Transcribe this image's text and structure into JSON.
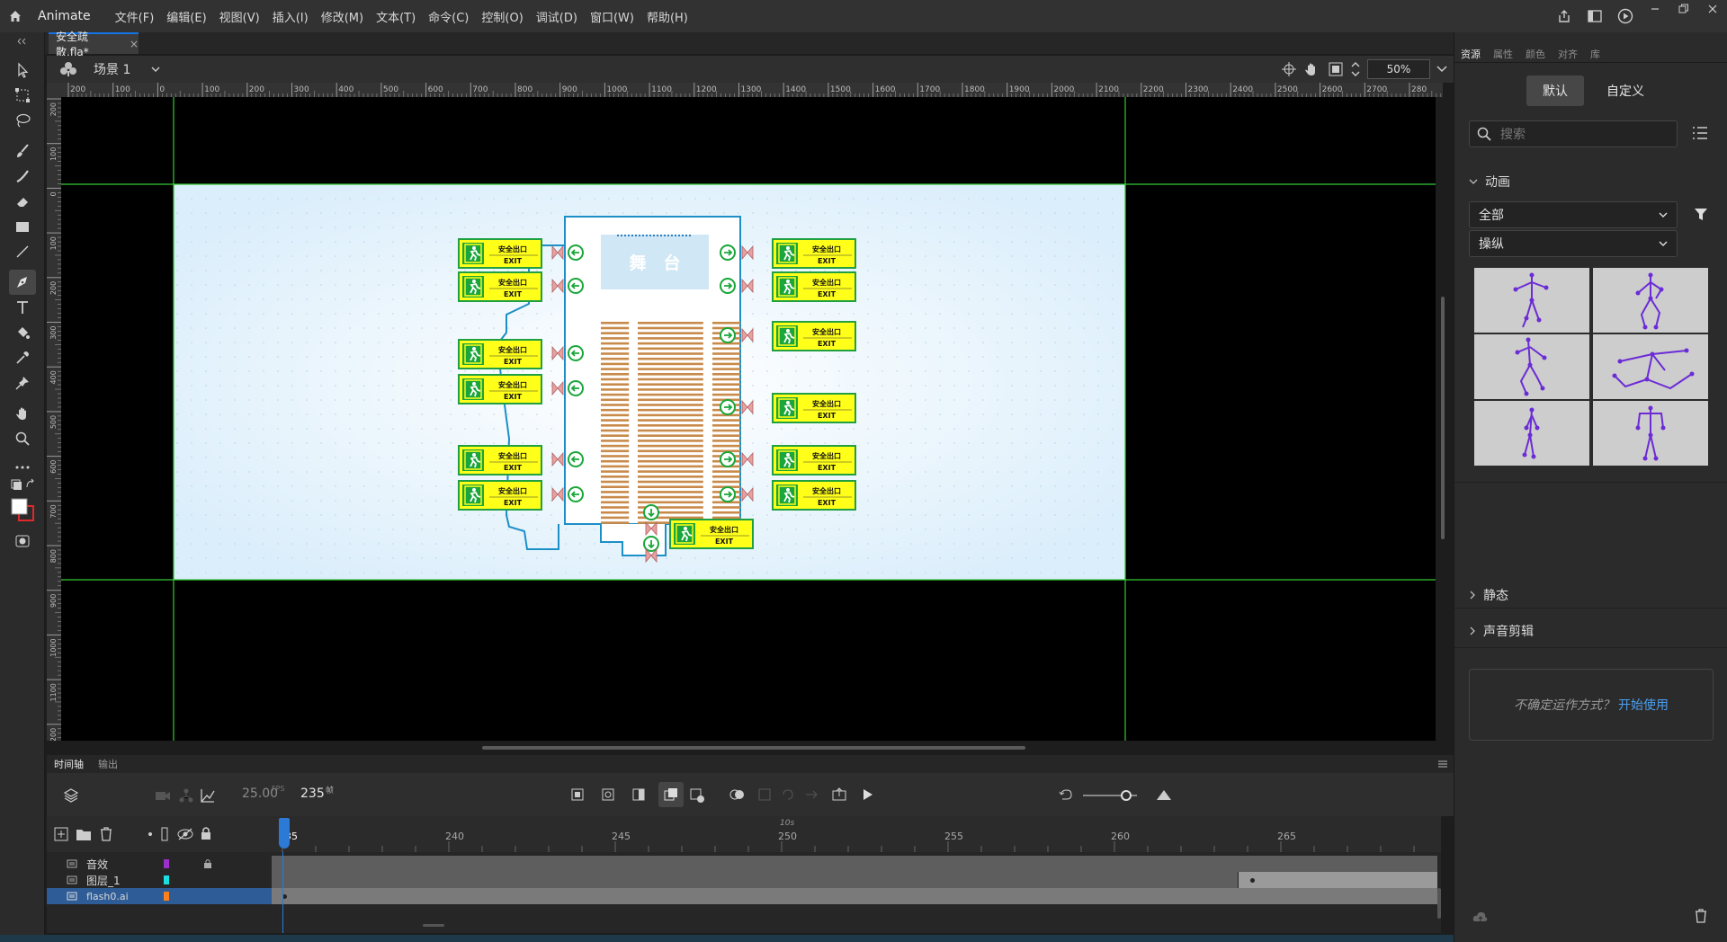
{
  "app": {
    "name": "Animate"
  },
  "menu": [
    "文件(F)",
    "编辑(E)",
    "视图(V)",
    "插入(I)",
    "修改(M)",
    "文本(T)",
    "命令(C)",
    "控制(O)",
    "调试(D)",
    "窗口(W)",
    "帮助(H)"
  ],
  "document": {
    "tab_title": "安全疏散.fla*",
    "close_glyph": "×"
  },
  "scene": {
    "name": "场景 1",
    "zoom": "50%"
  },
  "ruler": {
    "h_labels": [
      "200",
      "100",
      "0",
      "100",
      "200",
      "300",
      "400",
      "500",
      "600",
      "700",
      "800",
      "900",
      "1000",
      "1100",
      "1200",
      "1300",
      "1400",
      "1500",
      "1600",
      "1700",
      "1800",
      "1900",
      "2000",
      "2100",
      "2200",
      "2300",
      "2400",
      "2500",
      "2600",
      "2700",
      "280"
    ],
    "v_labels": [
      "200",
      "100",
      "0",
      "100",
      "200",
      "300",
      "400",
      "500",
      "600",
      "700",
      "800",
      "900",
      "1000",
      "1100",
      "1200"
    ]
  },
  "stage": {
    "stage_label": "舞　台",
    "exit_cn": "安全出口",
    "exit_en": "EXIT",
    "left_exits": 6,
    "right_exits": 6,
    "bottom_exits": 1
  },
  "timeline": {
    "tabs": [
      "时间轴",
      "输出"
    ],
    "fps": "25.00",
    "fps_unit": "FPS",
    "frame": "235",
    "frame_unit": "帧",
    "time_marker": "10s",
    "ruler_labels": [
      "235",
      "240",
      "245",
      "250",
      "255",
      "260",
      "265"
    ],
    "layers": [
      {
        "name": "音效",
        "color": "#9b30c8",
        "locked": true
      },
      {
        "name": "图层_1",
        "color": "#16e0e0",
        "locked": false
      },
      {
        "name": "flash0.ai",
        "color": "#ff7f1a",
        "locked": false
      }
    ]
  },
  "right_panel": {
    "tabs": [
      "资源",
      "属性",
      "颜色",
      "对齐",
      "库"
    ],
    "segment_default": "默认",
    "segment_custom": "自定义",
    "search_placeholder": "搜索",
    "section_animation": "动画",
    "dropdown_category": "全部",
    "dropdown_type": "操纵",
    "section_static": "静态",
    "section_sound": "声音剪辑",
    "info_text": "不确定运作方式？",
    "info_link": "开始使用"
  },
  "colors": {
    "accent": "#1473e6",
    "stage_bg": "#e6f3fd",
    "plan_line": "#1c8fc7",
    "exit_yellow": "#ffff1a",
    "exit_green": "#1aa63a",
    "seat": "#c88a4a",
    "guide": "#34c934"
  }
}
